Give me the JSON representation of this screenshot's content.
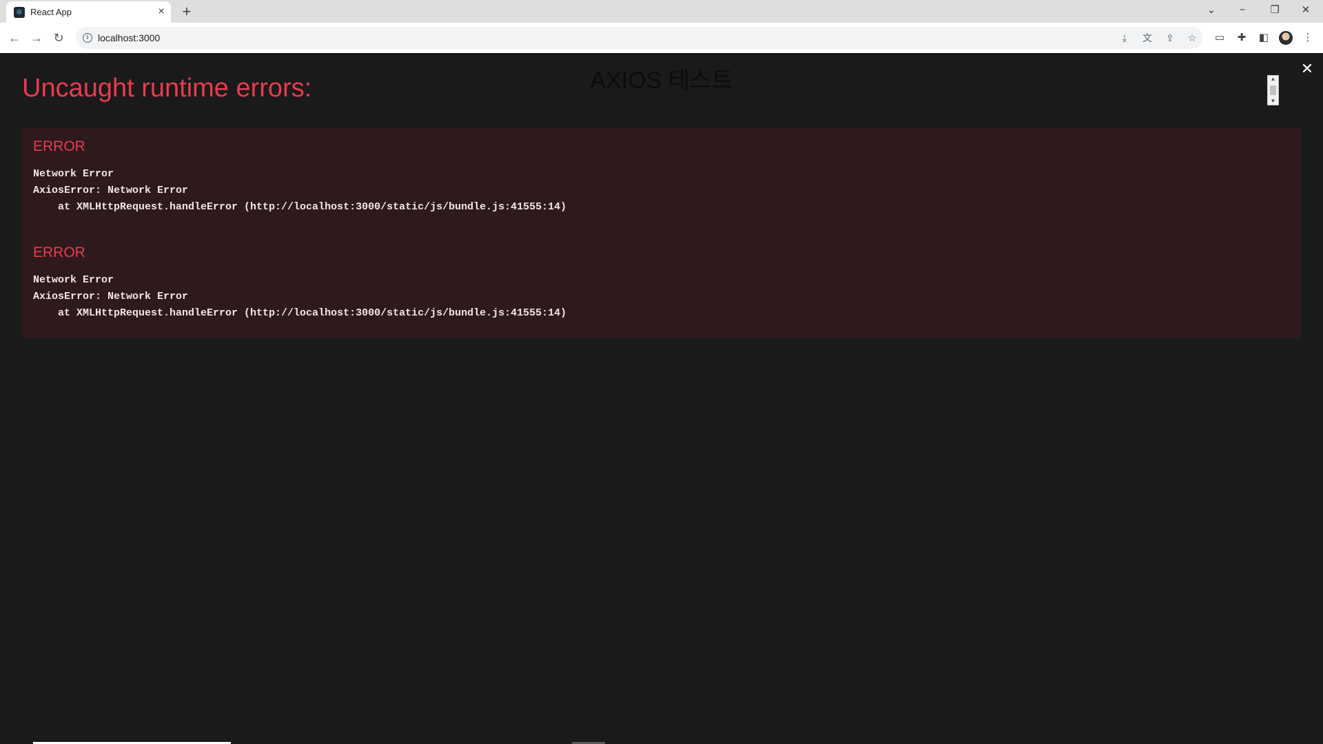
{
  "browser": {
    "tab": {
      "title": "React App",
      "favicon": "react-icon"
    },
    "address_bar": {
      "url": "localhost:3000"
    },
    "window_controls": [
      "chevron-down-icon",
      "minimize-icon",
      "restore-icon",
      "close-icon"
    ]
  },
  "page": {
    "heading": "AXIOS 테스트"
  },
  "overlay": {
    "title": "Uncaught runtime errors:",
    "errors": [
      {
        "header": "ERROR",
        "message": "Network Error",
        "stack": [
          "AxiosError: Network Error",
          "at XMLHttpRequest.handleError (http://localhost:3000/static/js/bundle.js:41555:14)"
        ]
      },
      {
        "header": "ERROR",
        "message": "Network Error",
        "stack": [
          "AxiosError: Network Error",
          "at XMLHttpRequest.handleError (http://localhost:3000/static/js/bundle.js:41555:14)"
        ]
      }
    ]
  },
  "colors": {
    "error_red": "#e83b4f",
    "overlay_bg": "#1a1a1a",
    "panel_bg": "#2e1a1c",
    "stack_text": "#f2e6e6"
  }
}
